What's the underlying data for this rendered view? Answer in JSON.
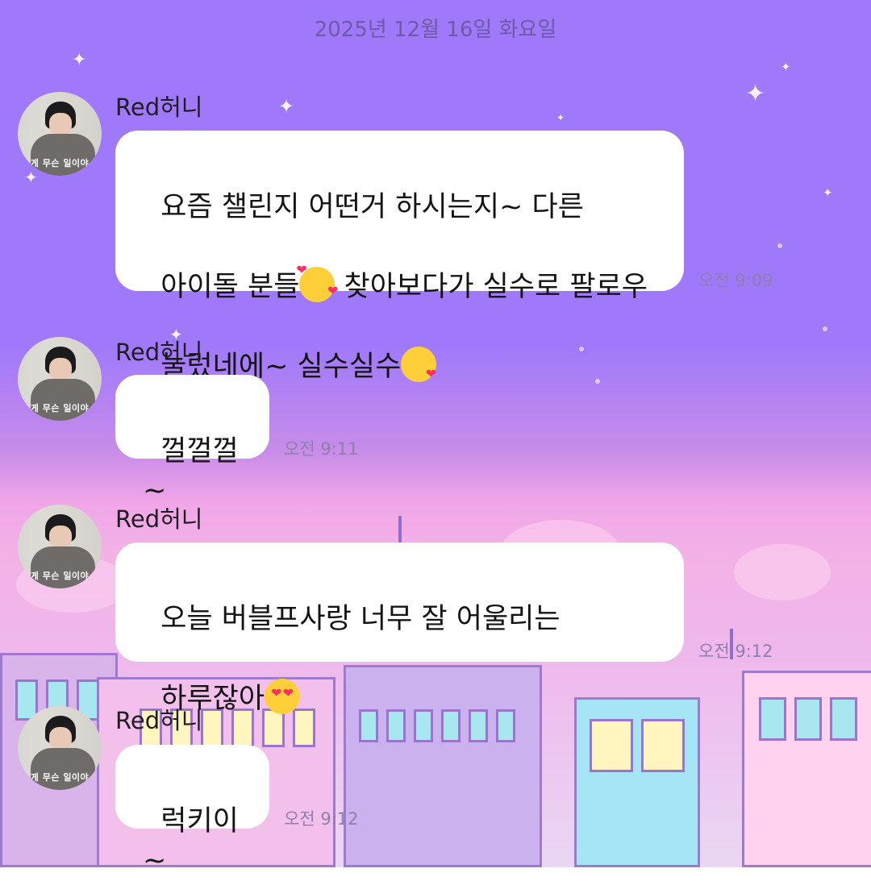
{
  "chat": {
    "date": "2025년 12월 16일 화요일",
    "messages": [
      {
        "sender": "Red허니",
        "avatar_caption": "게 무슨 일이야",
        "lines": [
          "요즘 챌린지 어떤거 하시는지~ 다른",
          "아이돌 분들",
          " 찾아보다가 실수로 팔로우",
          "눌렀네에~ 실수실수"
        ],
        "emojis": [
          "smiling-face-with-hearts",
          "face-blowing-a-kiss"
        ],
        "time": "오전 9:09"
      },
      {
        "sender": "Red허니",
        "avatar_caption": "게 무슨 일이야",
        "text": "껄껄껄~",
        "time": "오전 9:11"
      },
      {
        "sender": "Red허니",
        "avatar_caption": "게 무슨 일이야",
        "lines": [
          "오늘 버블프사랑 너무 잘 어울리는",
          "하루잖아"
        ],
        "emojis": [
          "smiling-face-with-heart-eyes"
        ],
        "time": "오전 9:12"
      },
      {
        "sender": "Red허니",
        "avatar_caption": "게 무슨 일이야",
        "text": "럭키이~",
        "time": "오전 9:12"
      }
    ]
  },
  "theme": {
    "sky_color": "#a079fb",
    "bubble_color": "#ffffff",
    "time_color": "#8f7fae"
  }
}
